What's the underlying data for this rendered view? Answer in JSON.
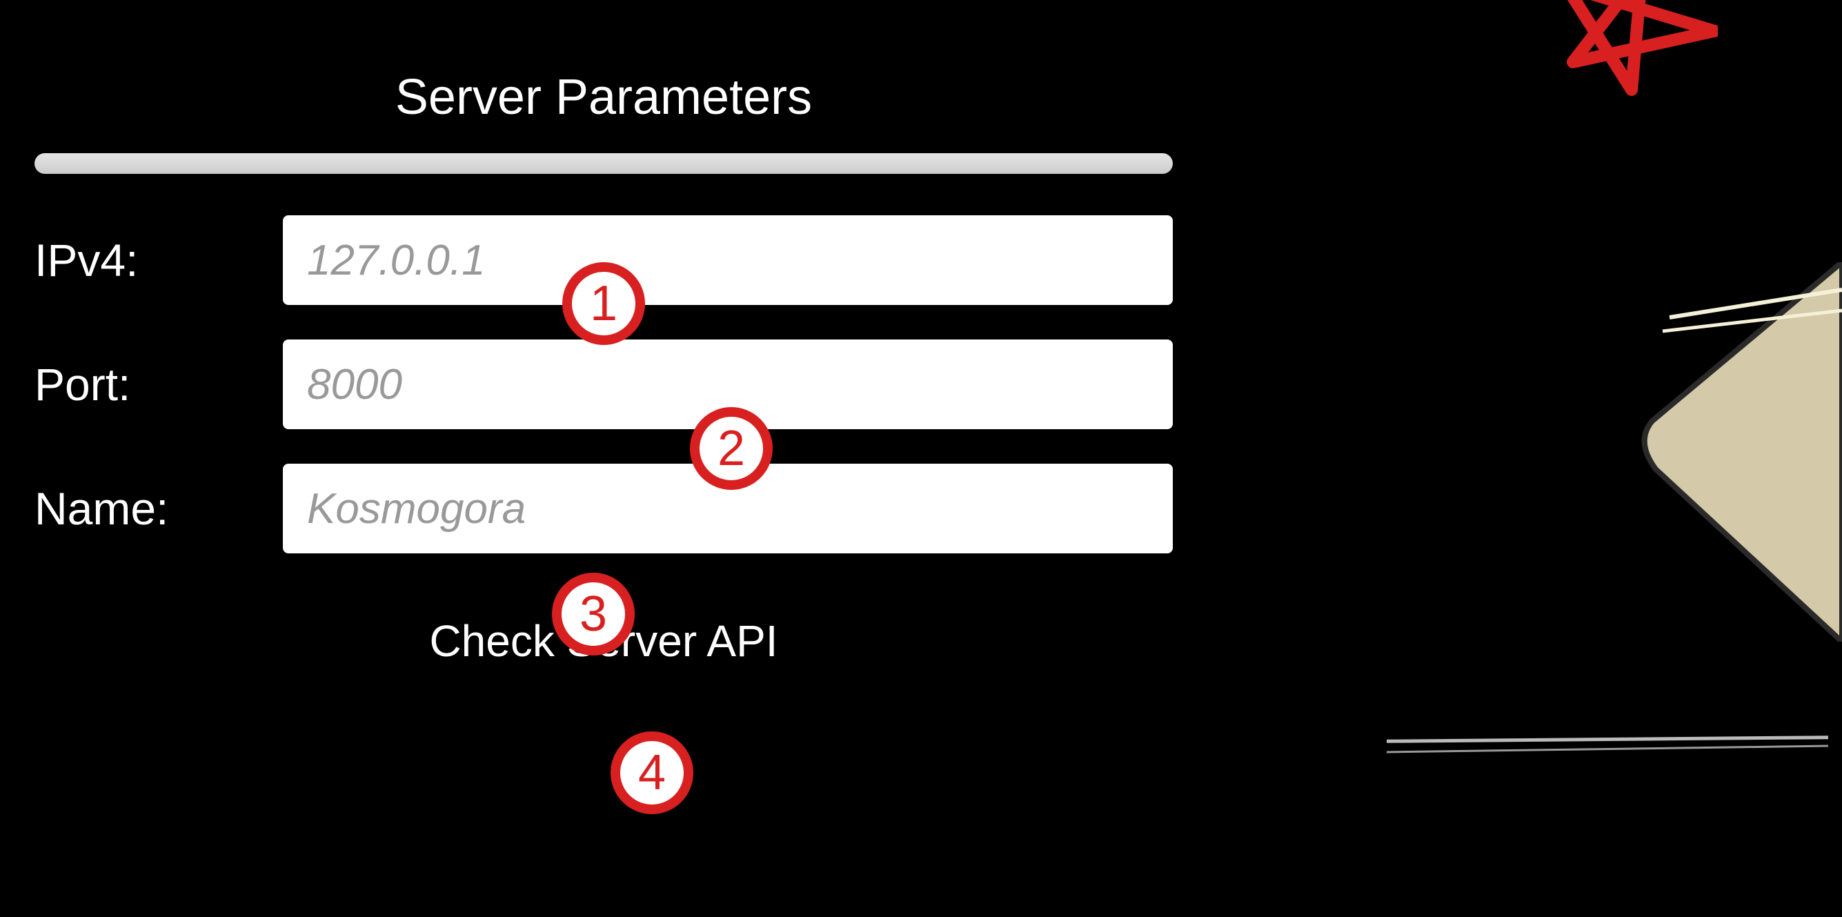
{
  "panel": {
    "title": "Server Parameters",
    "fields": {
      "ipv4": {
        "label": "IPv4:",
        "placeholder": "127.0.0.1",
        "value": ""
      },
      "port": {
        "label": "Port:",
        "placeholder": "8000",
        "value": ""
      },
      "name": {
        "label": "Name:",
        "placeholder": "Kosmogora",
        "value": ""
      }
    },
    "check_button_label": "Check Server API"
  },
  "badges": {
    "one": "1",
    "two": "2",
    "three": "3",
    "four": "4"
  }
}
